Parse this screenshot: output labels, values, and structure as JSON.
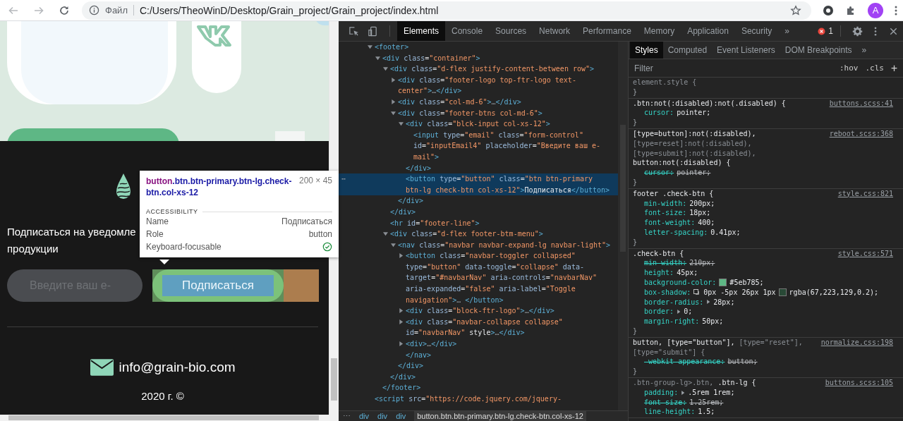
{
  "browser": {
    "file_label": "Файл",
    "url": "C:/Users/TheoWinD/Desktop/Grain_project/Grain_project/index.html",
    "profile_initial": "A"
  },
  "page": {
    "subscribe_text": "Подписаться на уведомле продукции",
    "email_placeholder": "Введите ваш е-",
    "subscribe_button": "Подписаться",
    "email": "info@grain-bio.com",
    "copyright": "2020 г. ©"
  },
  "tooltip": {
    "tag": "button",
    "classes": ".btn.btn-primary.btn-lg.check-btn.col-xs-12",
    "size": "200 × 45",
    "section": "ACCESSIBILITY",
    "rows": [
      {
        "label": "Name",
        "value": "Подписаться"
      },
      {
        "label": "Role",
        "value": "button"
      },
      {
        "label": "Keyboard-focusable",
        "focusable": true
      }
    ]
  },
  "devtools": {
    "tabs": [
      {
        "label": "Elements",
        "selected": true
      },
      {
        "label": "Console",
        "selected": false
      },
      {
        "label": "Sources",
        "selected": false
      },
      {
        "label": "Network",
        "selected": false
      },
      {
        "label": "Performance",
        "selected": false
      },
      {
        "label": "Memory",
        "selected": false
      },
      {
        "label": "Application",
        "selected": false
      },
      {
        "label": "Security",
        "selected": false
      }
    ],
    "more": "»",
    "error_count": "1",
    "dom_marker": "⋯",
    "dom_tree": [
      {
        "text": "<footer>",
        "expanded": true,
        "selected": false,
        "children": [
          {
            "text": "<div class=\"container\">",
            "expanded": true,
            "selected": false,
            "children": [
              {
                "text": "<div class=\"d-flex justify-content-between row\">",
                "expanded": true,
                "selected": false,
                "children": [
                  {
                    "text": "<div class=\"footer-logo top-ftr-logo text-center\">…</div>",
                    "expanded": false,
                    "selected": false
                  },
                  {
                    "text": "<div class=\"col-md-6\">…</div>",
                    "expanded": false,
                    "selected": false
                  },
                  {
                    "text": "<div class=\"footer-btns col-md-6\">",
                    "expanded": true,
                    "selected": false,
                    "children": [
                      {
                        "text": "<div class=\"blck-input col-xs-12\">",
                        "expanded": true,
                        "selected": false,
                        "children": [
                          {
                            "text": "<input type=\"email\" class=\"form-control\" id=\"inputEmail4\" placeholder=\"Введите ваш e-mail\">",
                            "selected": false
                          }
                        ]
                      },
                      {
                        "text": "</div>",
                        "selected": false
                      },
                      {
                        "text": "<button type=\"button\" class=\"btn btn-primary btn-lg check-btn col-xs-12\">Подписаться</button>",
                        "selected": true
                      }
                    ]
                  },
                  {
                    "text": "</div>",
                    "selected": false
                  }
                ]
              },
              {
                "text": "</div>",
                "selected": false
              },
              {
                "text": "<hr id=\"footer-line\">",
                "selected": false
              },
              {
                "text": "<div class=\"d-flex footer-btm-menu\">",
                "expanded": true,
                "selected": false,
                "children": [
                  {
                    "text": "<nav class=\"navbar navbar-expand-lg navbar-light\">",
                    "expanded": true,
                    "selected": false,
                    "children": [
                      {
                        "text": "<button class=\"navbar-toggler collapsed\" type=\"button\" data-toggle=\"collapse\" data-target=\"#navbarNav\" aria-controls=\"navbarNav\" aria-expanded=\"false\" aria-label=\"Toggle navigation\">… </button>",
                        "expanded": false,
                        "selected": false
                      },
                      {
                        "text": "<div class=\"block-ftr-logo\">…</div>",
                        "expanded": false,
                        "selected": false
                      },
                      {
                        "text": "<div class=\"navbar-collapse collapse\" id=\"navbarNav\" style>…</div>",
                        "expanded": false,
                        "selected": false
                      },
                      {
                        "text": "<div>…</div>",
                        "expanded": false,
                        "selected": false
                      },
                      {
                        "text": "</nav>",
                        "selected": false
                      }
                    ]
                  },
                  {
                    "text": "</div>",
                    "selected": false
                  }
                ]
              },
              {
                "text": "</div>",
                "selected": false
              }
            ]
          },
          {
            "text": "</footer>",
            "selected": false
          }
        ]
      },
      {
        "text": "<script src=\"https://code.jquery.com/jquery-",
        "selected": false
      }
    ],
    "breadcrumbs": [
      {
        "label": "div",
        "selected": false
      },
      {
        "label": "div",
        "selected": false
      },
      {
        "label": "div",
        "selected": false
      },
      {
        "label": "button.btn.btn-primary.btn-lg.check-btn.col-xs-12",
        "selected": true
      }
    ],
    "styles_tabs": [
      {
        "label": "Styles",
        "selected": true
      },
      {
        "label": "Computed",
        "selected": false
      },
      {
        "label": "Event Listeners",
        "selected": false
      },
      {
        "label": "DOM Breakpoints",
        "selected": false
      }
    ],
    "filter_placeholder": "Filter",
    "hov": ":hov",
    "cls": ".cls",
    "add": "+",
    "rules": [
      {
        "selector": [
          {
            "text": "element.style {",
            "matched": false
          }
        ],
        "close": "}"
      },
      {
        "selector": [
          {
            "text": ".btn:not(:disabled):not(.disabled) {",
            "matched": true
          }
        ],
        "source": "buttons.scss:41",
        "close": "}",
        "declarations": [
          {
            "property": "cursor:",
            "value": "pointer;",
            "overridden": false
          }
        ]
      },
      {
        "selector": [
          {
            "text": "[type=button]:not(:disabled),",
            "matched": true
          },
          {
            "text": "[type=reset]:not(:disabled), [type=submit]:not(:disabled),",
            "matched": false
          },
          {
            "text": "button:not(:disabled) {",
            "matched": true
          }
        ],
        "source": "reboot.scss:368",
        "close": "}",
        "declarations": [
          {
            "property": "cursor:",
            "value": "pointer;",
            "overridden": true
          }
        ]
      },
      {
        "selector": [
          {
            "text": "footer .check-btn {",
            "matched": true
          }
        ],
        "source": "style.css:821",
        "close": "}",
        "declarations": [
          {
            "property": "min-width:",
            "value": "200px;",
            "overridden": false
          },
          {
            "property": "font-size:",
            "value": "18px;",
            "overridden": false
          },
          {
            "property": "font-weight:",
            "value": "400;",
            "overridden": false
          },
          {
            "property": "letter-spacing:",
            "value": "0.41px;",
            "overridden": false
          }
        ]
      },
      {
        "selector": [
          {
            "text": ".check-btn {",
            "matched": true
          }
        ],
        "source": "style.css:571",
        "close": "}",
        "declarations": [
          {
            "property": "min-width:",
            "value": "210px;",
            "overridden": true
          },
          {
            "property": "height:",
            "value": "45px;",
            "overridden": false
          },
          {
            "property": "background-color:",
            "color_value": "#5eb785;",
            "overridden": false
          },
          {
            "property": "box-shadow:",
            "value": "0px -5px 26px 1px",
            "color_value": "rgba(67,223,129,0.2);",
            "overridden": false,
            "shadow_editor": true
          },
          {
            "property": "border-radius:",
            "value": "28px;",
            "overridden": false,
            "expandable": true
          },
          {
            "property": "border:",
            "value": "0;",
            "overridden": false,
            "expandable": true
          },
          {
            "property": "margin-right:",
            "value": "50px;",
            "overridden": false
          }
        ]
      },
      {
        "selector": [
          {
            "text": "button, [type=\"button\"],",
            "matched": true
          },
          {
            "text": "[type=\"reset\"], [type=\"submit\"] {",
            "matched": false
          }
        ],
        "source": "normalize.css:198",
        "close": "}",
        "declarations": [
          {
            "property": "-webkit-appearance:",
            "value": "button;",
            "overridden": true
          }
        ]
      },
      {
        "selector": [
          {
            "text": ".btn-group-lg>.btn,",
            "matched": false
          },
          {
            "text": ".btn-lg {",
            "matched": true
          }
        ],
        "source": "buttons.scss:105",
        "declarations": [
          {
            "property": "padding:",
            "value": ".5rem 1rem;",
            "overridden": false,
            "expandable": true
          },
          {
            "property": "font-size:",
            "value": "1.25rem;",
            "overridden": true
          },
          {
            "property": "line-height:",
            "value": "1.5;",
            "overridden": false
          }
        ]
      }
    ]
  }
}
